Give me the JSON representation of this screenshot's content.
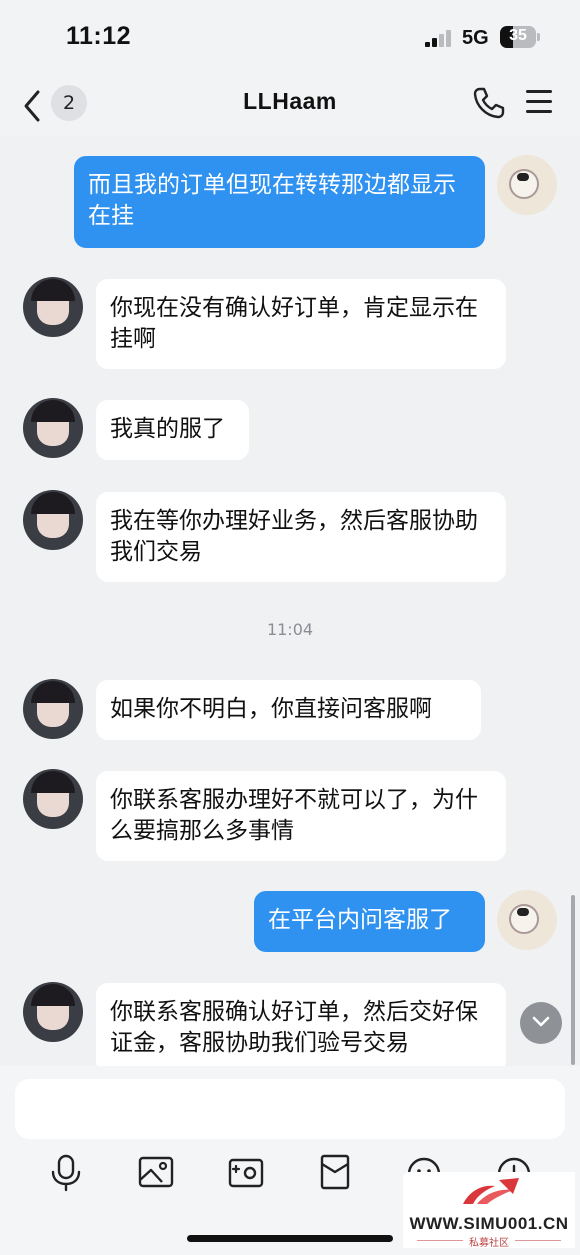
{
  "status_bar": {
    "time": "11:12",
    "network": "5G",
    "battery": "35",
    "battery_level": 0.35
  },
  "header": {
    "back_icon": "chevron-left-icon",
    "unread_count": "2",
    "title": "LLHaam",
    "call_icon": "phone-icon",
    "menu_icon": "menu-icon"
  },
  "messages": [
    {
      "side": "out",
      "text": "而且我的订单但现在转转那边都显示在挂"
    },
    {
      "side": "in",
      "text": "你现在没有确认好订单，肯定显示在挂啊"
    },
    {
      "side": "in",
      "text": "我真的服了"
    },
    {
      "side": "in",
      "text": "我在等你办理好业务，然后客服协助我们交易"
    },
    {
      "side": "in",
      "text": "如果你不明白，你直接问客服啊"
    },
    {
      "side": "in",
      "text": "你联系客服办理好不就可以了，为什么要搞那么多事情"
    },
    {
      "side": "out",
      "text": "在平台内问客服了"
    },
    {
      "side": "in",
      "text": "你联系客服确认好订单，然后交好保证金，客服协助我们验号交易"
    }
  ],
  "timestamp": "11:04",
  "input": {
    "placeholder": ""
  },
  "toolbar": [
    {
      "icon": "microphone-icon"
    },
    {
      "icon": "image-icon"
    },
    {
      "icon": "camera-icon"
    },
    {
      "icon": "red-packet-icon"
    },
    {
      "icon": "emoji-icon"
    },
    {
      "icon": "plus-icon"
    }
  ],
  "watermark": {
    "url": "WWW.SIMU001.CN",
    "subtitle": "私募社区"
  }
}
